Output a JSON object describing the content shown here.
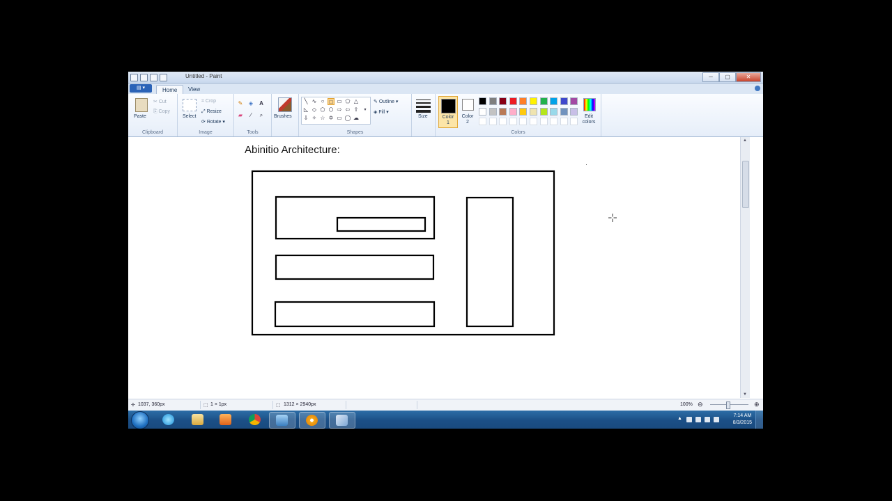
{
  "window": {
    "title": "Untitled - Paint",
    "min": "─",
    "max": "▢",
    "close": "✕"
  },
  "tabs": {
    "file": "▤ ▾",
    "home": "Home",
    "view": "View"
  },
  "clipboard": {
    "paste": "Paste",
    "cut": "Cut",
    "copy": "Copy",
    "group": "Clipboard"
  },
  "image": {
    "select": "Select",
    "crop": "Crop",
    "resize": "Resize",
    "rotate": "Rotate ▾",
    "group": "Image"
  },
  "tools": {
    "group": "Tools"
  },
  "brushes": {
    "label": "Brushes"
  },
  "shapes": {
    "outline": "Outline ▾",
    "fill": "Fill ▾",
    "group": "Shapes"
  },
  "size": {
    "label": "Size"
  },
  "colors": {
    "color1": "Color 1",
    "color2": "Color 2",
    "edit": "Edit colors",
    "group": "Colors",
    "row1": [
      "#000000",
      "#7f7f7f",
      "#880015",
      "#ed1c24",
      "#ff7f27",
      "#fff200",
      "#22b14c",
      "#00a2e8",
      "#3f48cc",
      "#a349a4"
    ],
    "row2": [
      "#ffffff",
      "#c3c3c3",
      "#b97a57",
      "#ffaec9",
      "#ffc90e",
      "#efe4b0",
      "#b5e61d",
      "#99d9ea",
      "#7092be",
      "#c8bfe7"
    ]
  },
  "document": {
    "heading": "Abinitio Architecture:"
  },
  "status": {
    "cursor_pos": "1037, 360px",
    "selection": "1 × 1px",
    "canvas_size": "1312 × 2940px",
    "zoom": "100%"
  },
  "taskbar": {
    "time": "7:14 AM",
    "date": "8/3/2015"
  }
}
